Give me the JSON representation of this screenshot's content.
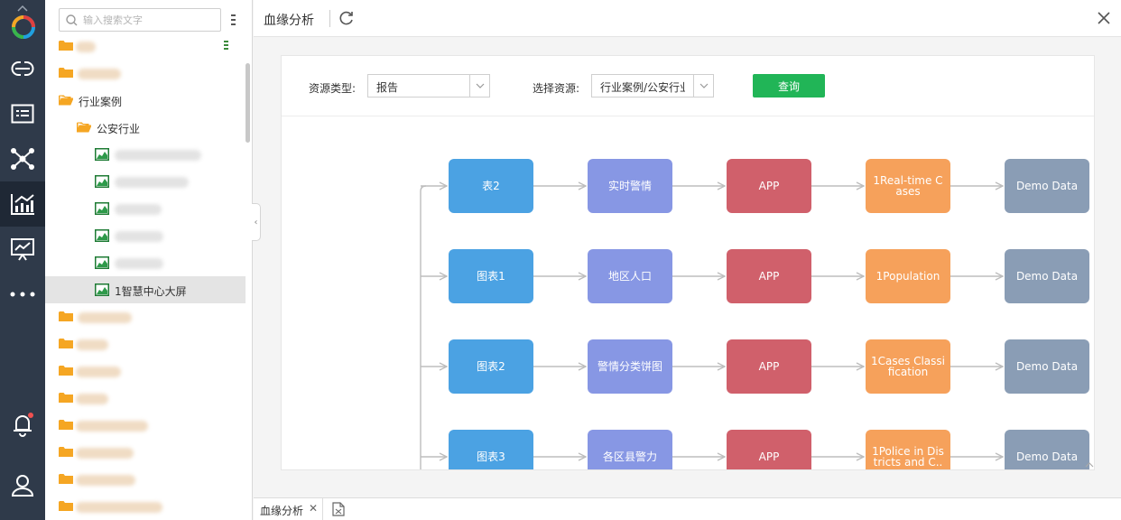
{
  "sidebar": {
    "search_placeholder": "输入搜索文字",
    "folder_industry_cases": "行业案例",
    "folder_public_security": "公安行业",
    "selected_report": "1智慧中心大屏"
  },
  "header": {
    "title": "血缘分析"
  },
  "filters": {
    "resource_type_label": "资源类型:",
    "resource_type_value": "报告",
    "select_resource_label": "选择资源:",
    "select_resource_value": "行业案例/公安行业",
    "query_button": "查询"
  },
  "graph": {
    "rows": [
      [
        "表2",
        "实时警情",
        "APP",
        "1Real-time Cases",
        "Demo Data"
      ],
      [
        "图表1",
        "地区人口",
        "APP",
        "1Population",
        "Demo Data"
      ],
      [
        "图表2",
        "警情分类饼图",
        "APP",
        "1Cases Classification",
        "Demo Data"
      ],
      [
        "图表3",
        "各区县警力",
        "APP",
        "1Police in Districts and C..",
        "Demo Data"
      ]
    ]
  },
  "tabs": {
    "active_tab": "血缘分析"
  },
  "colors": {
    "rail_bg": "#2f3a4a",
    "col1": "#4ba2e3",
    "col2": "#8797e4",
    "col3": "#d0606b",
    "col4": "#f6a15b",
    "col5": "#8a9db5",
    "query_button": "#21b557",
    "folder": "#f5a623",
    "notify_dot": "#f05050"
  },
  "icons": {
    "rail": [
      "logo-icon",
      "link-icon",
      "list-icon",
      "network-icon",
      "chart-icon",
      "presentation-icon",
      "more-icon",
      "bell-icon",
      "user-icon"
    ],
    "header": [
      "refresh-icon",
      "close-icon"
    ],
    "tree": [
      "search-icon",
      "menu-icon",
      "folder-icon",
      "report-icon"
    ]
  }
}
